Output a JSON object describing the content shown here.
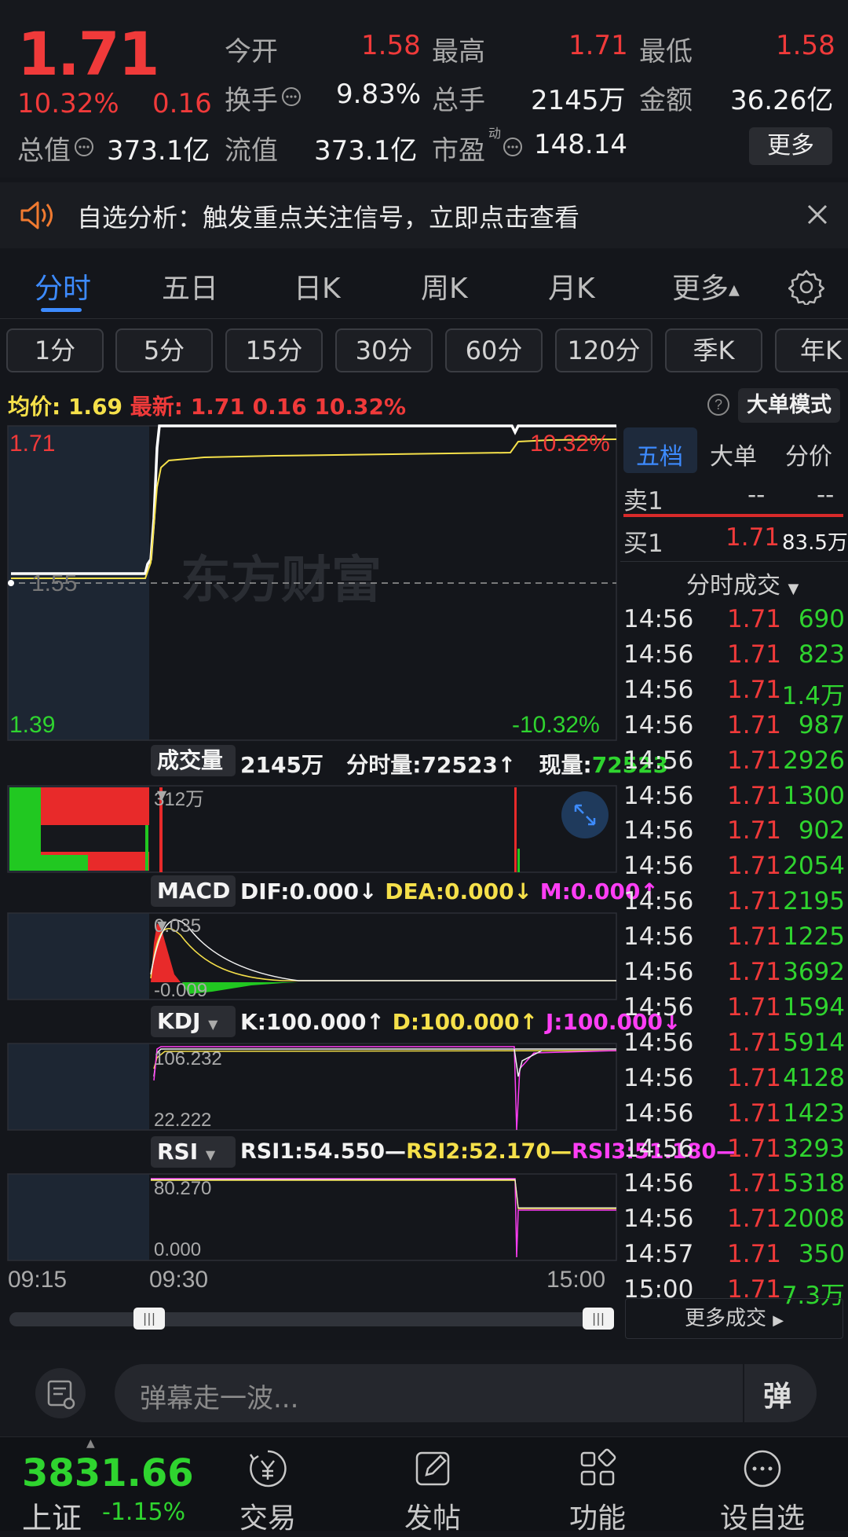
{
  "quote": {
    "price": "1.71",
    "change_pct": "10.32%",
    "change": "0.16",
    "open_label": "今开",
    "open": "1.58",
    "high_label": "最高",
    "high": "1.71",
    "low_label": "最低",
    "low": "1.58",
    "turnover_label": "换手",
    "turnover": "9.83%",
    "volume_label": "总手",
    "volume": "2145万",
    "amount_label": "金额",
    "amount": "36.26亿",
    "mktcap_label": "总值",
    "mktcap": "373.1亿",
    "float_label": "流值",
    "float": "373.1亿",
    "pe_label": "市盈",
    "pe_sup": "动",
    "pe": "148.14",
    "more": "更多"
  },
  "banner": {
    "text": "自选分析：触发重点关注信号，立即点击查看"
  },
  "period_tabs": [
    "分时",
    "五日",
    "日K",
    "周K",
    "月K",
    "更多"
  ],
  "minute_chips": [
    "1分",
    "5分",
    "15分",
    "30分",
    "60分",
    "120分",
    "季K",
    "年K"
  ],
  "info": {
    "avg_label": "均价:",
    "avg": "1.69",
    "latest_label": "最新:",
    "latest": "1.71",
    "latest_change": "0.16",
    "latest_pct": "10.32%",
    "big_order": "大单模式"
  },
  "chart": {
    "price_top": "1.71",
    "pct_top": "10.32%",
    "price_mid": "1.55",
    "price_bottom": "1.39",
    "pct_bottom": "-10.32%",
    "watermark": "东方财富",
    "vol_label": "成交量",
    "vol_total": "2145万",
    "vol_minute_label": "分时量:",
    "vol_minute": "72523↑",
    "vol_now_label": "现量:",
    "vol_now": "72523",
    "vol_scale": "312万",
    "macd_label": "MACD",
    "macd_dif": "DIF:0.000↓",
    "macd_dea": "DEA:0.000↓",
    "macd_m": "M:0.000↑",
    "macd_top": "0.035",
    "macd_bottom": "-0.009",
    "kdj_label": "KDJ",
    "kdj_k": "K:100.000↑",
    "kdj_d": "D:100.000↑",
    "kdj_j": "J:100.000↓",
    "kdj_top": "106.232",
    "kdj_bottom": "22.222",
    "rsi_label": "RSI",
    "rsi1": "RSI1:54.550—",
    "rsi2": "RSI2:52.170—",
    "rsi3": "RSI3:51.180—",
    "rsi_top": "80.270",
    "rsi_bottom": "0.000",
    "time_start": "09:15",
    "time_open": "09:30",
    "time_end": "15:00"
  },
  "right_panel": {
    "tabs": [
      "五档",
      "大单",
      "分价"
    ],
    "sell1_label": "卖1",
    "sell1_price": "--",
    "sell1_vol": "--",
    "buy1_label": "买1",
    "buy1_price": "1.71",
    "buy1_vol": "83.5万",
    "ticks_title": "分时成交",
    "ticks": [
      {
        "time": "14:56",
        "price": "1.71",
        "vol": "690"
      },
      {
        "time": "14:56",
        "price": "1.71",
        "vol": "823"
      },
      {
        "time": "14:56",
        "price": "1.71",
        "vol": "1.4万"
      },
      {
        "time": "14:56",
        "price": "1.71",
        "vol": "987"
      },
      {
        "time": "14:56",
        "price": "1.71",
        "vol": "2926"
      },
      {
        "time": "14:56",
        "price": "1.71",
        "vol": "1300"
      },
      {
        "time": "14:56",
        "price": "1.71",
        "vol": "902"
      },
      {
        "time": "14:56",
        "price": "1.71",
        "vol": "2054"
      },
      {
        "time": "14:56",
        "price": "1.71",
        "vol": "2195"
      },
      {
        "time": "14:56",
        "price": "1.71",
        "vol": "1225"
      },
      {
        "time": "14:56",
        "price": "1.71",
        "vol": "3692"
      },
      {
        "time": "14:56",
        "price": "1.71",
        "vol": "1594"
      },
      {
        "time": "14:56",
        "price": "1.71",
        "vol": "5914"
      },
      {
        "time": "14:56",
        "price": "1.71",
        "vol": "4128"
      },
      {
        "time": "14:56",
        "price": "1.71",
        "vol": "1423"
      },
      {
        "time": "14:56",
        "price": "1.71",
        "vol": "3293"
      },
      {
        "time": "14:56",
        "price": "1.71",
        "vol": "5318"
      },
      {
        "time": "14:56",
        "price": "1.71",
        "vol": "2008"
      },
      {
        "time": "14:57",
        "price": "1.71",
        "vol": "350"
      },
      {
        "time": "15:00",
        "price": "1.71",
        "vol": "7.3万"
      }
    ],
    "more_trades": "更多成交"
  },
  "comment": {
    "placeholder": "弹幕走一波...",
    "danmu": "弹"
  },
  "nav": {
    "index_value": "3831.66",
    "index_name": "上证",
    "index_pct": "-1.15%",
    "items": [
      "交易",
      "发帖",
      "功能",
      "设自选"
    ]
  },
  "colors": {
    "up": "#f03a3a",
    "down": "#2fd42f",
    "accent": "#3d8bff",
    "avg": "#f5e04a"
  }
}
